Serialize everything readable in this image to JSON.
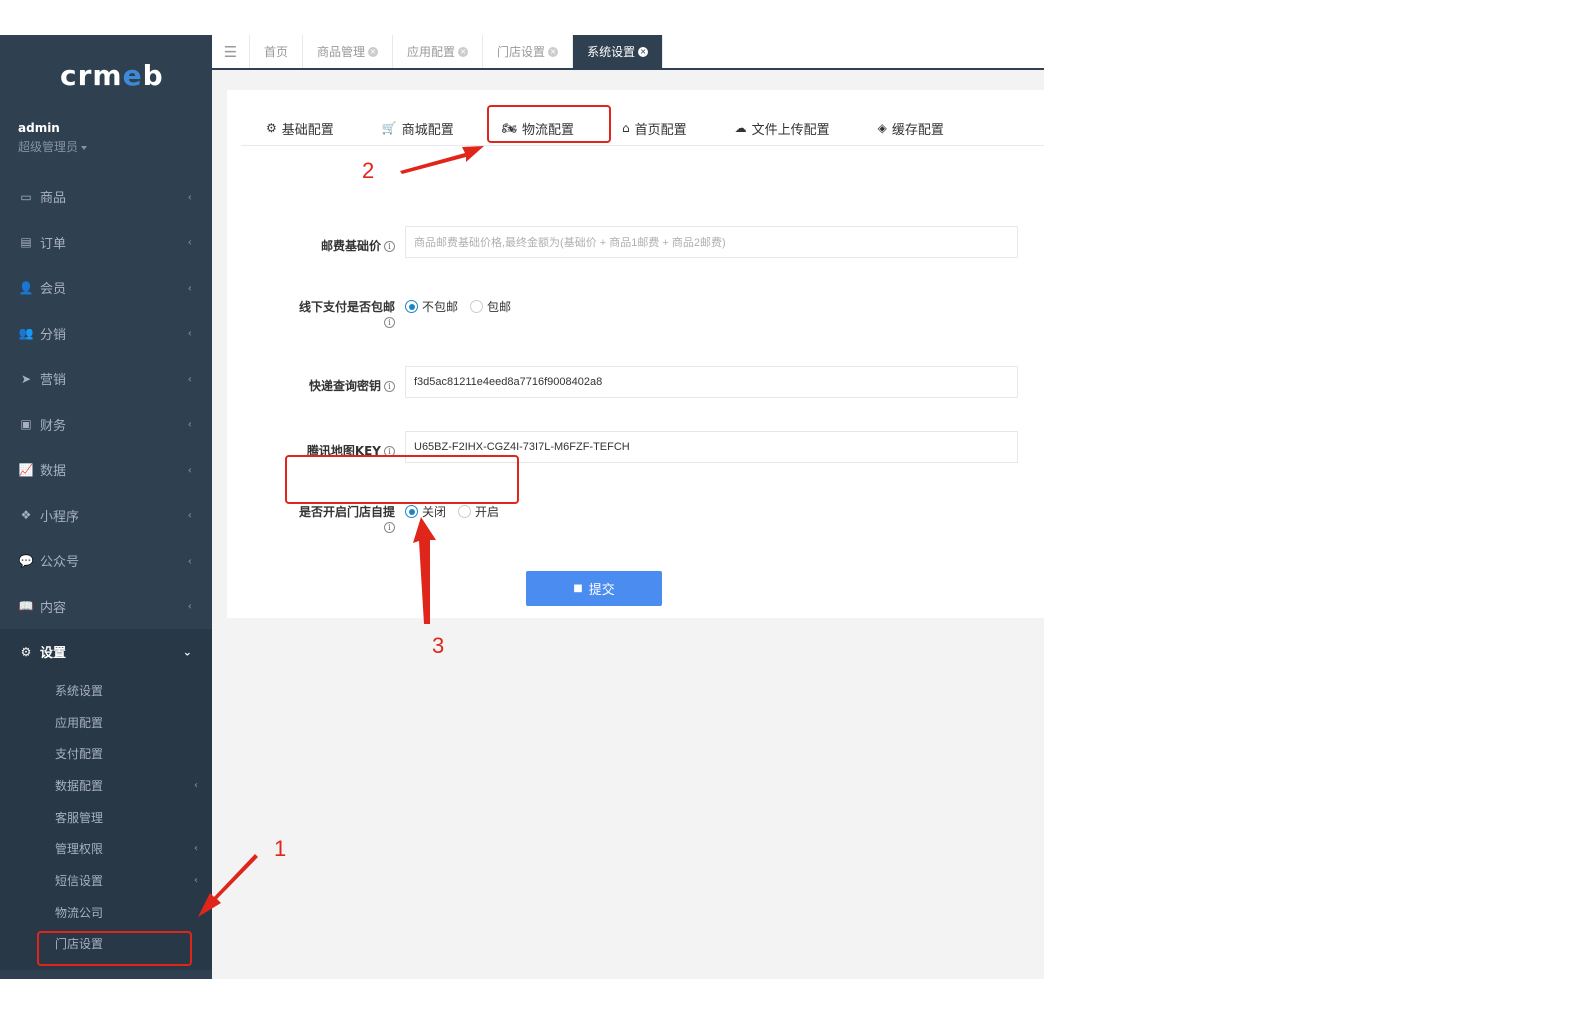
{
  "logo": {
    "text_a": "crm",
    "text_b": "e",
    "text_c": "b"
  },
  "user": {
    "name": "admin",
    "role": "超级管理员"
  },
  "nav": [
    {
      "label": "商品",
      "icon": "laptop-icon",
      "glyph": "▭"
    },
    {
      "label": "订单",
      "icon": "list-icon",
      "glyph": "▤"
    },
    {
      "label": "会员",
      "icon": "user-icon",
      "glyph": "👤"
    },
    {
      "label": "分销",
      "icon": "users-icon",
      "glyph": "👥"
    },
    {
      "label": "营销",
      "icon": "send-icon",
      "glyph": "➤"
    },
    {
      "label": "财务",
      "icon": "money-icon",
      "glyph": "▣"
    },
    {
      "label": "数据",
      "icon": "line-chart-icon",
      "glyph": "📈"
    },
    {
      "label": "小程序",
      "icon": "cubes-icon",
      "glyph": "❖"
    },
    {
      "label": "公众号",
      "icon": "wechat-icon",
      "glyph": "💬"
    },
    {
      "label": "内容",
      "icon": "book-icon",
      "glyph": "📖"
    },
    {
      "label": "设置",
      "icon": "gear-icon",
      "glyph": "⚙"
    }
  ],
  "subnav": [
    {
      "label": "系统设置",
      "has_chevron": false
    },
    {
      "label": "应用配置",
      "has_chevron": false
    },
    {
      "label": "支付配置",
      "has_chevron": false
    },
    {
      "label": "数据配置",
      "has_chevron": true
    },
    {
      "label": "客服管理",
      "has_chevron": false
    },
    {
      "label": "管理权限",
      "has_chevron": true
    },
    {
      "label": "短信设置",
      "has_chevron": true
    },
    {
      "label": "物流公司",
      "has_chevron": false
    },
    {
      "label": "门店设置",
      "has_chevron": false
    }
  ],
  "tabs": [
    {
      "label": "首页",
      "closable": false
    },
    {
      "label": "商品管理",
      "closable": true
    },
    {
      "label": "应用配置",
      "closable": true
    },
    {
      "label": "门店设置",
      "closable": true
    },
    {
      "label": "系统设置",
      "closable": true,
      "active": true
    }
  ],
  "subtabs": [
    {
      "label": "基础配置",
      "icon": "gear-icon",
      "glyph": "⚙"
    },
    {
      "label": "商城配置",
      "icon": "cart-icon",
      "glyph": "🛒"
    },
    {
      "label": "物流配置",
      "icon": "motorcycle-icon",
      "glyph": "🏍"
    },
    {
      "label": "首页配置",
      "icon": "home-icon",
      "glyph": "⌂"
    },
    {
      "label": "文件上传配置",
      "icon": "cloud-upload-icon",
      "glyph": "☁"
    },
    {
      "label": "缓存配置",
      "icon": "cube-icon",
      "glyph": "◈"
    }
  ],
  "form": {
    "postage_label": "邮费基础价",
    "postage_placeholder": "商品邮费基础价格,最终金额为(基础价 + 商品1邮费 + 商品2邮费)",
    "offline_label": "线下支付是否包邮",
    "offline_opt1": "不包邮",
    "offline_opt2": "包邮",
    "express_label": "快递查询密钥",
    "express_value": "f3d5ac81211e4eed8a7716f9008402a8",
    "tencent_label": "腾讯地图KEY",
    "tencent_value": "U65BZ-F2IHX-CGZ4I-73I7L-M6FZF-TEFCH",
    "store_label": "是否开启门店自提",
    "store_opt1": "关闭",
    "store_opt2": "开启",
    "submit_label": "提交"
  },
  "annotations": {
    "n1": "1",
    "n2": "2",
    "n3": "3"
  },
  "colors": {
    "sidebar": "#2f4050",
    "accent": "#4a8cf0",
    "annotation": "#e0251b",
    "radio": "#1c84c6"
  }
}
